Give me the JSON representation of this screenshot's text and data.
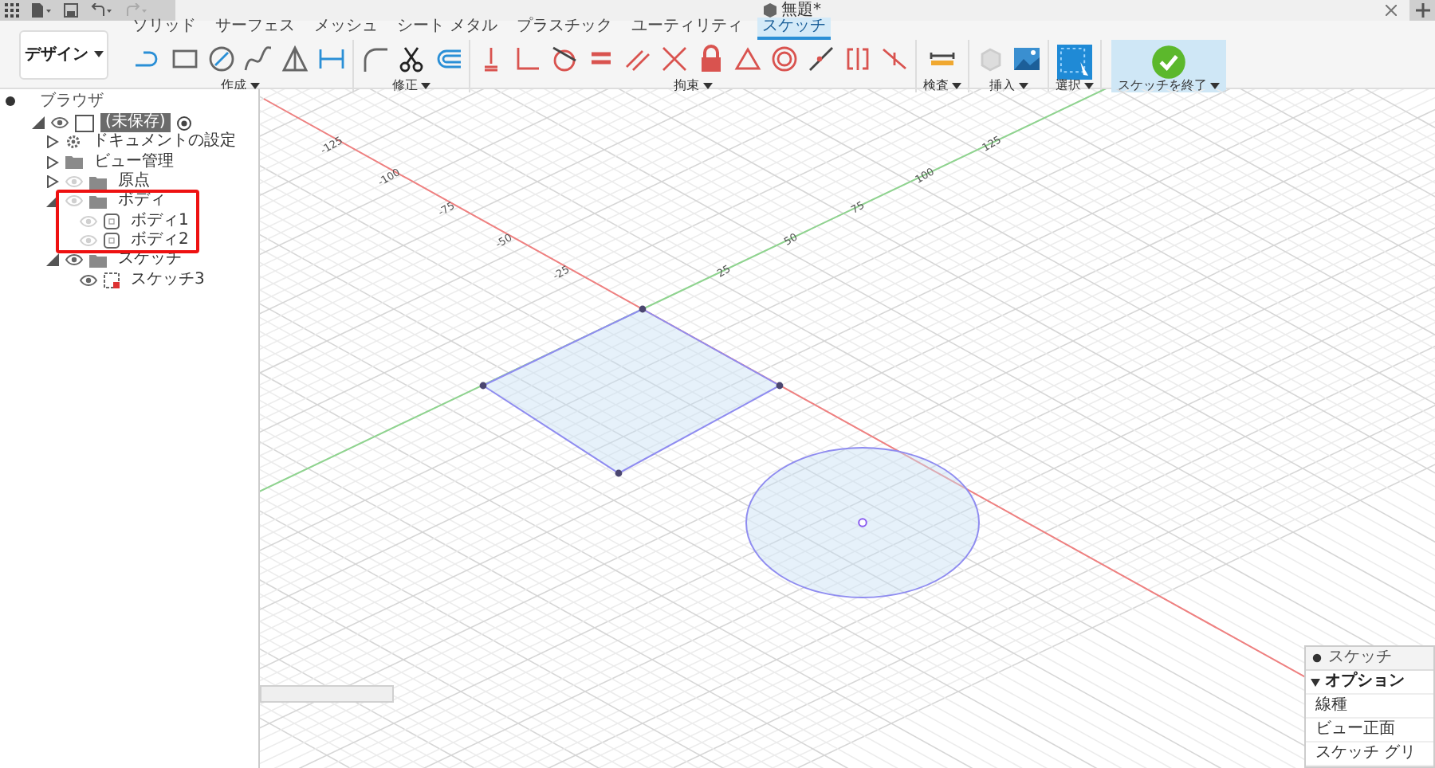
{
  "title_bar": {
    "document_title": "無題*"
  },
  "ribbon": {
    "workspace": "デザイン",
    "tabs": [
      {
        "label": "ソリッド",
        "selected": false
      },
      {
        "label": "サーフェス",
        "selected": false
      },
      {
        "label": "メッシュ",
        "selected": false
      },
      {
        "label": "シート メタル",
        "selected": false
      },
      {
        "label": "プラスチック",
        "selected": false
      },
      {
        "label": "ユーティリティ",
        "selected": false
      },
      {
        "label": "スケッチ",
        "selected": true
      }
    ],
    "groups": [
      {
        "label": "作成",
        "kind": "create"
      },
      {
        "label": "修正",
        "kind": "modify"
      },
      {
        "label": "拘束",
        "kind": "constraints"
      },
      {
        "label": "検査",
        "kind": "inspect"
      },
      {
        "label": "挿入",
        "kind": "insert"
      },
      {
        "label": "選択",
        "kind": "select"
      },
      {
        "label": "スケッチを終了",
        "kind": "finish"
      }
    ]
  },
  "browser": {
    "title": "ブラウザ",
    "tree": [
      {
        "label": "(未保存)",
        "kind": "component",
        "visible": true,
        "expanded": true,
        "children": [
          {
            "label": "ドキュメントの設定",
            "kind": "settings",
            "expanded": false
          },
          {
            "label": "ビュー管理",
            "kind": "folder",
            "expanded": false
          },
          {
            "label": "原点",
            "kind": "folder",
            "visible": false,
            "expanded": false
          },
          {
            "label": "ボディ",
            "kind": "folder",
            "visible": false,
            "expanded": true,
            "children": [
              {
                "label": "ボディ1",
                "kind": "body",
                "visible": false
              },
              {
                "label": "ボディ2",
                "kind": "body",
                "visible": false
              }
            ]
          },
          {
            "label": "スケッチ",
            "kind": "folder",
            "visible": true,
            "expanded": true,
            "children": [
              {
                "label": "スケッチ3",
                "kind": "sketch",
                "visible": true
              }
            ]
          }
        ]
      }
    ]
  },
  "viewport": {
    "axis_1_labels": [
      "-25",
      "-50",
      "-75",
      "-100",
      "-125"
    ],
    "axis_2_labels": [
      "25",
      "50",
      "75",
      "100",
      "125"
    ]
  },
  "sketch_palette": {
    "title": "スケッチ",
    "section": "オプション",
    "rows": [
      "線種",
      "ビュー正面",
      "スケッチ グリ"
    ]
  }
}
